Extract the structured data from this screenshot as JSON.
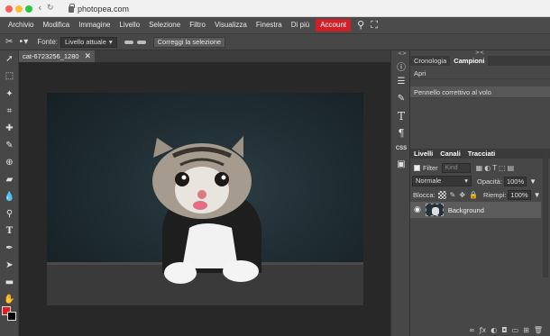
{
  "browser": {
    "url": "photopea.com",
    "traffic_lights": [
      "#ff5f57",
      "#febc2e",
      "#28c840"
    ]
  },
  "menu": {
    "items": [
      "Archivio",
      "Modifica",
      "Immagine",
      "Livello",
      "Selezione",
      "Filtro",
      "Visualizza",
      "Finestra",
      "Di più"
    ],
    "account_label": "Account",
    "account_color": "#d21f27",
    "icons": [
      "search-icon",
      "fullscreen-icon"
    ]
  },
  "options": {
    "source_label": "Fonte:",
    "source_value": "Livello attuale",
    "correct_button": "Correggi la selezione"
  },
  "document": {
    "tab_title": "cat-6723256_1280",
    "close_glyph": "✕"
  },
  "tools": {
    "foreground_color": "#e21b1b",
    "background_color": "#000000"
  },
  "history_panel": {
    "tabs": [
      "Cronologia",
      "Campioni"
    ],
    "active_tab": "Campioni",
    "entries": [
      "Apri",
      "Pennello correttivo al volo"
    ]
  },
  "layers_panel": {
    "tabs": [
      "Livelli",
      "Canali",
      "Tracciati"
    ],
    "filter_label": "Filter",
    "kind_placeholder": "Kind",
    "blend_mode": "Normale",
    "opacity_label": "Opacità:",
    "opacity_value": "100%",
    "lock_label": "Blocca:",
    "fill_label": "Riempi:",
    "fill_value": "100%",
    "layers": [
      {
        "name": "Background",
        "visible": true
      }
    ]
  },
  "right_icons": {
    "css_label": "CSS"
  }
}
